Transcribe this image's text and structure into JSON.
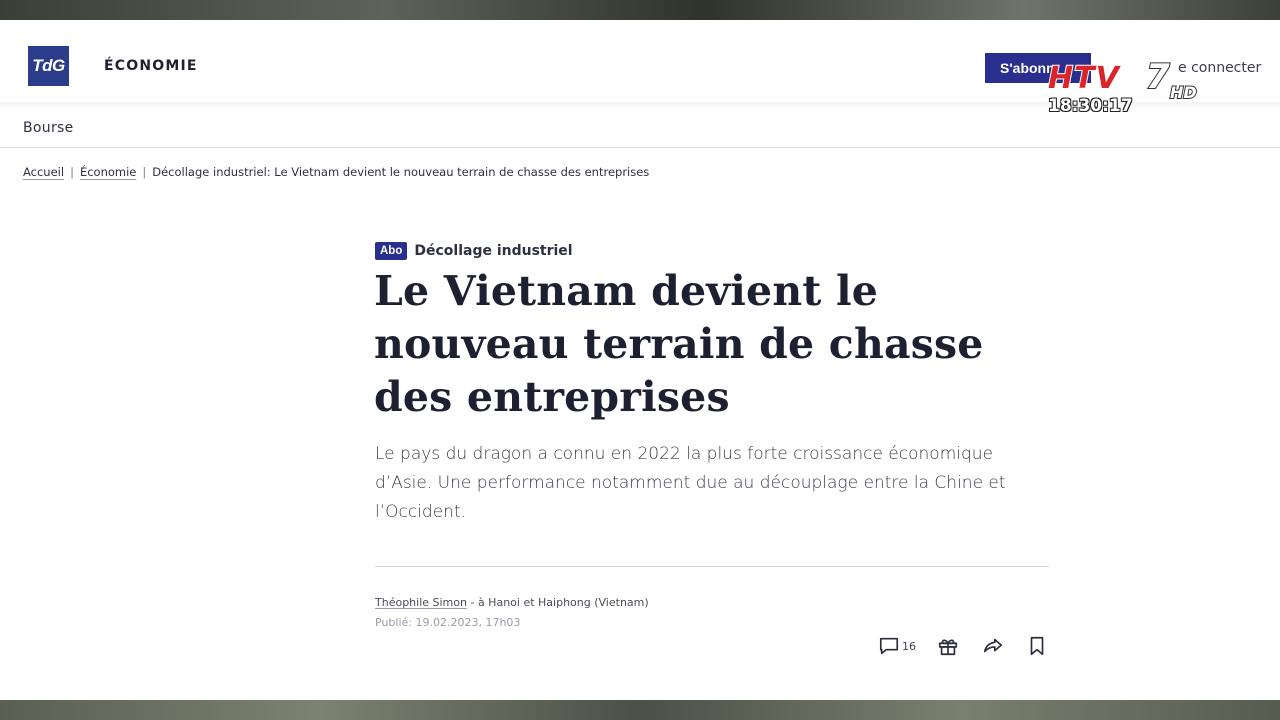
{
  "header": {
    "logo_text": "TdG",
    "section": "ÉCONOMIE",
    "subscribe_label": "S'abonn",
    "login_label": "e connecter"
  },
  "subnav": {
    "item": "Bourse"
  },
  "breadcrumb": {
    "items": [
      "Accueil",
      "Économie",
      "Décollage industriel: Le Vietnam devient le nouveau terrain de chasse des entreprises"
    ]
  },
  "article": {
    "badge": "Abo",
    "kicker": "Décollage industriel",
    "headline": "Le Vietnam devient le nouveau terrain de chasse des entreprises",
    "lead": "Le pays du dragon a connu en 2022 la plus forte croissance économique d’Asie. Une performance notamment due au découplage entre la Chine et l’Occident.",
    "author": "Théophile Simon",
    "location": " - à Hanoi et Haiphong (Vietnam)",
    "published": "Publié: 19.02.2023, 17h03",
    "comment_count": "16"
  },
  "actions": {
    "icons": [
      "comment-icon",
      "gift-icon",
      "share-icon",
      "bookmark-icon"
    ]
  },
  "overlay": {
    "channel_letters": "HTV",
    "channel_number": "7",
    "channel_hd": "HD",
    "clock": "18:30:17"
  },
  "colors": {
    "brand": "#2b3d8a",
    "button": "#2a2f8f",
    "text": "#1f2130"
  }
}
